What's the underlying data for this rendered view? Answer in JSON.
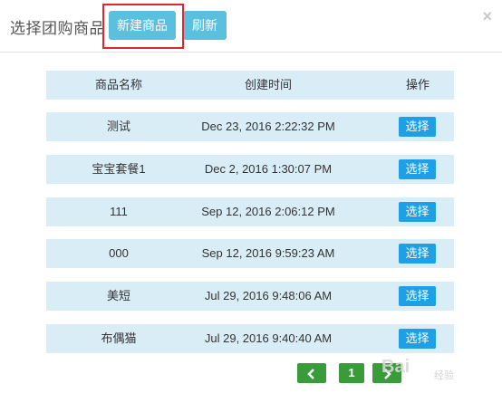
{
  "header": {
    "title": "选择团购商品",
    "new_button_label": "新建商品",
    "refresh_button_label": "刷新",
    "close_label": "×"
  },
  "table": {
    "columns": [
      "商品名称",
      "创建时间",
      "操作"
    ],
    "rows": [
      {
        "name": "测试",
        "created": "Dec 23, 2016 2:22:32 PM",
        "action": "选择"
      },
      {
        "name": "宝宝套餐1",
        "created": "Dec 2, 2016 1:30:07 PM",
        "action": "选择"
      },
      {
        "name": "111",
        "created": "Sep 12, 2016 2:06:12 PM",
        "action": "选择"
      },
      {
        "name": "000",
        "created": "Sep 12, 2016 9:59:23 AM",
        "action": "选择"
      },
      {
        "name": "美短",
        "created": "Jul 29, 2016 9:48:06 AM",
        "action": "选择"
      },
      {
        "name": "布偶猫",
        "created": "Jul 29, 2016 9:40:40 AM",
        "action": "选择"
      }
    ]
  },
  "pagination": {
    "prev_icon": "chevron-left-icon",
    "current_page": "1",
    "next_icon": "chevron-right-icon"
  },
  "watermark": {
    "text": "Bai",
    "sub": "经验"
  },
  "colors": {
    "info_button": "#5bc0de",
    "row_bg": "#d9edf7",
    "select_button": "#1e9fe6",
    "pager": "#3a9b3a",
    "highlight": "#e0262d"
  }
}
